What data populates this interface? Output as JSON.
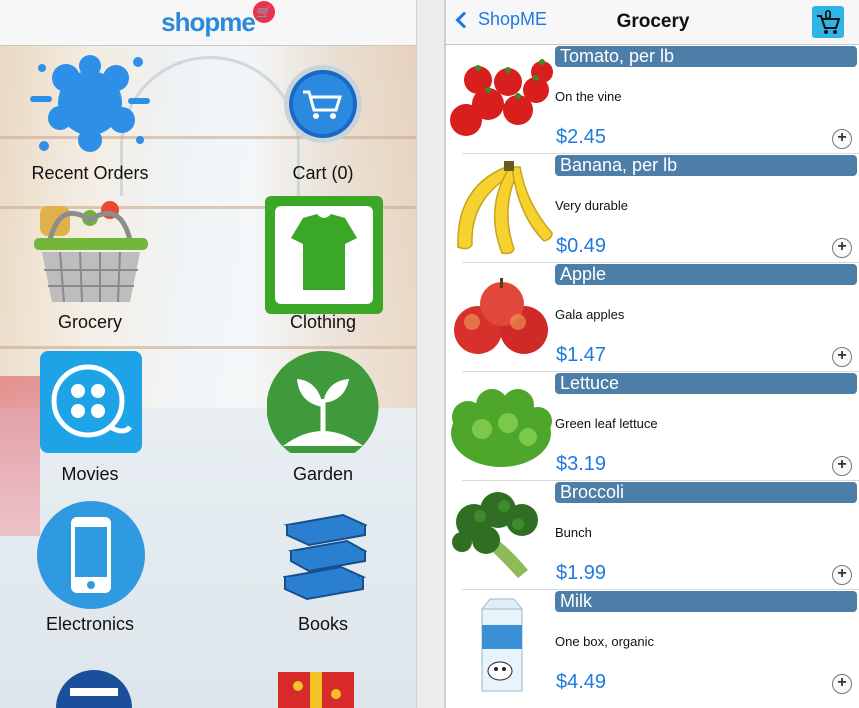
{
  "left": {
    "logo_text": "shopme",
    "tiles": [
      {
        "label": "Recent Orders",
        "icon": "paint-splash-icon"
      },
      {
        "label": "Cart (0)",
        "icon": "cart-icon"
      },
      {
        "label": "Grocery",
        "icon": "grocery-basket-icon"
      },
      {
        "label": "Clothing",
        "icon": "tshirt-icon"
      },
      {
        "label": "Movies",
        "icon": "film-reel-icon"
      },
      {
        "label": "Garden",
        "icon": "sprout-icon"
      },
      {
        "label": "Electronics",
        "icon": "phone-icon"
      },
      {
        "label": "Books",
        "icon": "books-icon"
      }
    ]
  },
  "right": {
    "back_label": "ShopME",
    "title": "Grocery",
    "cart_count": "0",
    "items": [
      {
        "name": "Tomato, per lb",
        "desc": "On the vine",
        "price": "$2.45",
        "icon": "tomato-image"
      },
      {
        "name": "Banana, per lb",
        "desc": "Very durable",
        "price": "$0.49",
        "icon": "banana-image"
      },
      {
        "name": "Apple",
        "desc": "Gala apples",
        "price": "$1.47",
        "icon": "apple-image"
      },
      {
        "name": "Lettuce",
        "desc": "Green leaf lettuce",
        "price": "$3.19",
        "icon": "lettuce-image"
      },
      {
        "name": "Broccoli",
        "desc": "Bunch",
        "price": "$1.99",
        "icon": "broccoli-image"
      },
      {
        "name": "Milk",
        "desc": "One box, organic",
        "price": "$4.49",
        "icon": "milk-carton-image"
      }
    ]
  },
  "colors": {
    "accent_blue": "#1f7ae0",
    "name_bar": "#4d7ea8",
    "clothing_green": "#3aa826",
    "garden_green": "#3f9a3c",
    "movies_blue": "#1ea4e6"
  }
}
